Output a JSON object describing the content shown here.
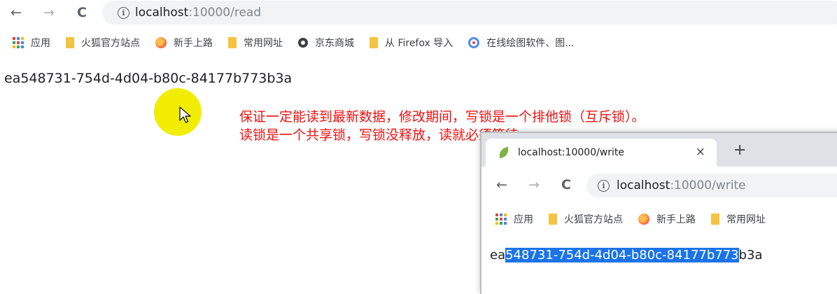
{
  "main_browser": {
    "back_glyph": "←",
    "forward_glyph": "→",
    "reload_glyph": "C",
    "url_host": "localhost",
    "url_rest": ":10000/read",
    "bookmarks": [
      {
        "icon": "apps-grid-icon",
        "label": "应用"
      },
      {
        "icon": "folder-icon",
        "label": "火狐官方站点"
      },
      {
        "icon": "firefox-icon",
        "label": "新手上路"
      },
      {
        "icon": "folder-icon",
        "label": "常用网址"
      },
      {
        "icon": "globe-icon",
        "label": "京东商城"
      },
      {
        "icon": "folder-icon",
        "label": "从 Firefox 导入"
      },
      {
        "icon": "drawing-app-icon",
        "label": "在线绘图软件、图..."
      }
    ],
    "page_text": "ea548731-754d-4d04-b80c-84177b773b3a"
  },
  "annotation": {
    "line1": "保证一定能读到最新数据，修改期间，写锁是一个排他锁（互斥锁）。",
    "line2": "读锁是一个共享锁，写锁没释放，读就必须等待",
    "color": "#ee1111",
    "highlight_color": "#f2ec03"
  },
  "overlay_browser": {
    "tab_title": "localhost:10000/write",
    "tab_close": "×",
    "new_tab": "+",
    "back_glyph": "←",
    "forward_glyph": "→",
    "reload_glyph": "C",
    "url_host": "localhost",
    "url_rest": ":10000/write",
    "bookmarks": [
      {
        "icon": "apps-grid-icon",
        "label": "应用"
      },
      {
        "icon": "folder-icon",
        "label": "火狐官方站点"
      },
      {
        "icon": "firefox-icon",
        "label": "新手上路"
      },
      {
        "icon": "folder-icon",
        "label": "常用网址"
      }
    ],
    "page_text_before": "ea",
    "page_text_selected": "548731-754d-4d04-b80c-84177b773",
    "page_text_after": "b3a",
    "selection_color": "#1a73e8"
  }
}
